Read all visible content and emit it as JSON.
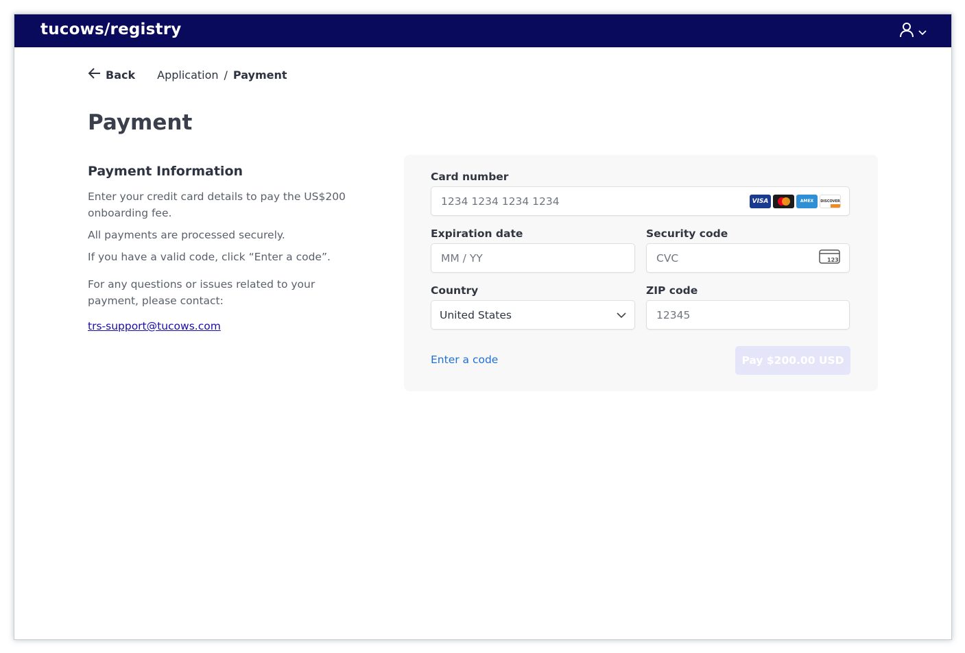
{
  "header": {
    "logo_text": "tucows/registry",
    "background_color": "#0a0a5c",
    "user_icon": "user-icon",
    "menu_icon": "chevron-down-icon"
  },
  "nav": {
    "back_label": "Back",
    "breadcrumb": [
      "Application",
      "/",
      "Payment"
    ]
  },
  "page": {
    "title": "Payment"
  },
  "info": {
    "heading": "Payment Information",
    "paragraph_1": "Enter your credit card details to pay the US$200 onboarding fee.",
    "paragraph_2": "All payments are processed securely.",
    "paragraph_3": "If you have a valid code, click “Enter a code”.",
    "paragraph_4": "For any questions or issues related to your payment, please contact:",
    "support_email": "trs-support@tucows.com"
  },
  "form": {
    "card_number": {
      "label": "Card number",
      "placeholder": "1234 1234 1234 1234",
      "brands": [
        "VISA",
        "mastercard",
        "AMEX",
        "DISCOVER"
      ]
    },
    "expiration": {
      "label": "Expiration date",
      "placeholder": "MM / YY"
    },
    "security": {
      "label": "Security code",
      "placeholder": "CVC",
      "icon_text": "123"
    },
    "country": {
      "label": "Country",
      "value": "United States"
    },
    "zip": {
      "label": "ZIP code",
      "placeholder": "12345"
    },
    "enter_code_label": "Enter a code",
    "pay_button_label": "Pay $200.00 USD"
  },
  "colors": {
    "link": "#1f6fd6",
    "pay_button_disabled": "#e4e5f8"
  }
}
